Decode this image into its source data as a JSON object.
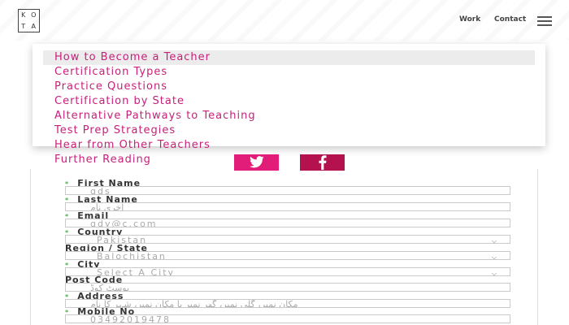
{
  "header": {
    "logo_letters": [
      "K",
      "O",
      "T",
      "A"
    ],
    "nav": [
      "Work",
      "Contact"
    ]
  },
  "menu": {
    "items": [
      "How to Become a Teacher",
      "Certification Types",
      "Practice Questions",
      "Certification by State",
      "Alternative Pathways to Teaching",
      "Test Prep Strategies",
      "Hear from Other Teachers",
      "Further Reading"
    ],
    "highlighted_index": 0
  },
  "form": {
    "first_name": {
      "label": "First Name",
      "value": "gds"
    },
    "last_name": {
      "label": "Last Name",
      "value": "اخری نام"
    },
    "email": {
      "label": "Email",
      "value": "gdy@c.com"
    },
    "country": {
      "label": "Country",
      "value": "Pakistan"
    },
    "region": {
      "label": "Region / State",
      "value": "Balochistan"
    },
    "city": {
      "label": "City",
      "value": "Select A City"
    },
    "post_code": {
      "label": "Post Code",
      "value": "پوسٹ کوڈ"
    },
    "address": {
      "label": "Address",
      "value": "مکان نمبر، گلی نمبر، گھر نمبر یا مکان نمبر، شہر کا نام"
    },
    "mobile": {
      "label": "Mobile No",
      "value": "03492019478"
    }
  },
  "colors": {
    "accent": "#c71f7a",
    "twitter_bg": "#e11d79",
    "facebook_bg": "#b3124f",
    "required": "#4caf50"
  }
}
